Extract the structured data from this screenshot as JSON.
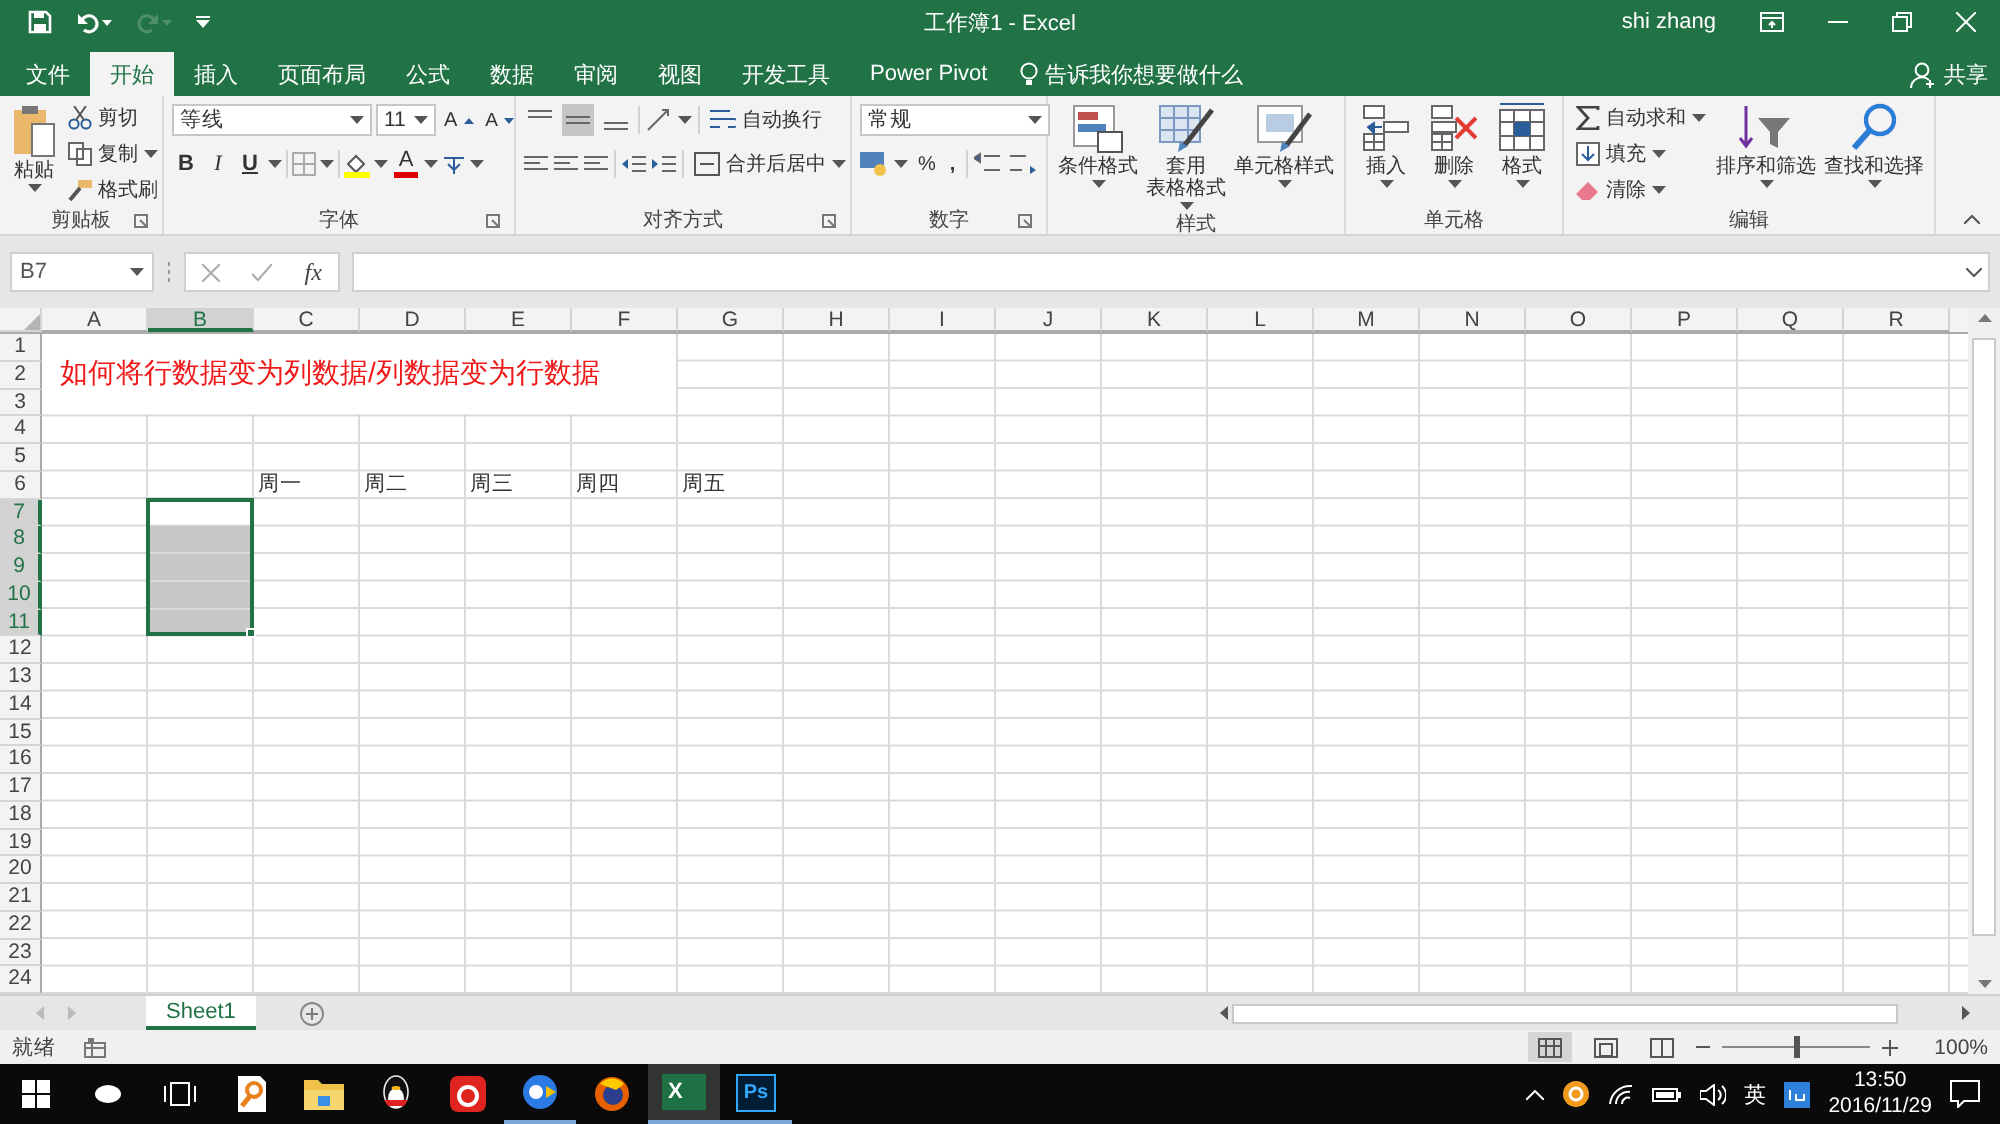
{
  "title_bar": {
    "title": "工作簿1 - Excel",
    "user": "shi zhang",
    "redo_disabled": true
  },
  "menu_tabs": [
    {
      "label": "文件",
      "selected": false
    },
    {
      "label": "开始",
      "selected": true
    },
    {
      "label": "插入",
      "selected": false
    },
    {
      "label": "页面布局",
      "selected": false
    },
    {
      "label": "公式",
      "selected": false
    },
    {
      "label": "数据",
      "selected": false
    },
    {
      "label": "审阅",
      "selected": false
    },
    {
      "label": "视图",
      "selected": false
    },
    {
      "label": "开发工具",
      "selected": false
    },
    {
      "label": "Power Pivot",
      "selected": false
    }
  ],
  "tell_me": "告诉我你想要做什么",
  "share": "共享",
  "ribbon": {
    "clipboard": {
      "label": "剪贴板",
      "paste": "粘贴",
      "cut": "剪切",
      "copy": "复制",
      "format_painter": "格式刷"
    },
    "font": {
      "label": "字体",
      "font_name": "等线",
      "font_size": "11",
      "grow": "A",
      "shrink": "A",
      "bold": "B",
      "italic": "I",
      "underline": "U",
      "font_color": "A"
    },
    "alignment": {
      "label": "对齐方式",
      "vertical": [
        {
          "kind": "top",
          "selected": false
        },
        {
          "kind": "middle",
          "selected": true
        },
        {
          "kind": "bottom",
          "selected": false
        }
      ],
      "wrap": "自动换行",
      "merge": "合并后居中"
    },
    "number": {
      "label": "数字",
      "format": "常规",
      "percent": "%",
      "comma": ","
    },
    "styles": {
      "label": "样式",
      "buttons": [
        {
          "kind": "conditional",
          "lines": [
            "条件格式"
          ]
        },
        {
          "kind": "table",
          "lines": [
            "套用",
            "表格格式"
          ]
        },
        {
          "kind": "cell",
          "lines": [
            "单元格样式"
          ]
        }
      ]
    },
    "cells": {
      "label": "单元格",
      "buttons": [
        {
          "kind": "insert",
          "label": "插入"
        },
        {
          "kind": "delete",
          "label": "删除"
        },
        {
          "kind": "format",
          "label": "格式"
        }
      ]
    },
    "editing": {
      "label": "编辑",
      "autosum": "自动求和",
      "fill": "填充",
      "clear": "清除",
      "sort": "排序和筛选",
      "find": "查找和选择"
    }
  },
  "formula_bar": {
    "name_box": "B7",
    "fx": "fx"
  },
  "sheet": {
    "columns": [
      {
        "label": "A",
        "selected": false
      },
      {
        "label": "B",
        "selected": true
      },
      {
        "label": "C",
        "selected": false
      },
      {
        "label": "D",
        "selected": false
      },
      {
        "label": "E",
        "selected": false
      },
      {
        "label": "F",
        "selected": false
      },
      {
        "label": "G",
        "selected": false
      },
      {
        "label": "H",
        "selected": false
      },
      {
        "label": "I",
        "selected": false
      },
      {
        "label": "J",
        "selected": false
      },
      {
        "label": "K",
        "selected": false
      },
      {
        "label": "L",
        "selected": false
      },
      {
        "label": "M",
        "selected": false
      },
      {
        "label": "N",
        "selected": false
      },
      {
        "label": "O",
        "selected": false
      },
      {
        "label": "P",
        "selected": false
      },
      {
        "label": "Q",
        "selected": false
      },
      {
        "label": "R",
        "selected": false
      }
    ],
    "rows": [
      {
        "label": "1",
        "selected": false
      },
      {
        "label": "2",
        "selected": false
      },
      {
        "label": "3",
        "selected": false
      },
      {
        "label": "4",
        "selected": false
      },
      {
        "label": "5",
        "selected": false
      },
      {
        "label": "6",
        "selected": false
      },
      {
        "label": "7",
        "selected": true
      },
      {
        "label": "8",
        "selected": true
      },
      {
        "label": "9",
        "selected": true
      },
      {
        "label": "10",
        "selected": true
      },
      {
        "label": "11",
        "selected": true
      },
      {
        "label": "12",
        "selected": false
      },
      {
        "label": "13",
        "selected": false
      },
      {
        "label": "14",
        "selected": false
      },
      {
        "label": "15",
        "selected": false
      },
      {
        "label": "16",
        "selected": false
      },
      {
        "label": "17",
        "selected": false
      },
      {
        "label": "18",
        "selected": false
      },
      {
        "label": "19",
        "selected": false
      },
      {
        "label": "20",
        "selected": false
      },
      {
        "label": "21",
        "selected": false
      },
      {
        "label": "22",
        "selected": false
      },
      {
        "label": "23",
        "selected": false
      },
      {
        "label": "24",
        "selected": false
      }
    ],
    "title": "如何将行数据变为列数据/列数据变为行数据",
    "weekdays": [
      "周一",
      "周二",
      "周三",
      "周四",
      "周五"
    ]
  },
  "sheet_tabs": [
    {
      "label": "Sheet1",
      "selected": true
    }
  ],
  "status_bar": {
    "status": "就绪",
    "zoom_slider": {
      "level": 0.5
    },
    "zoom": "100%"
  },
  "taskbar": {
    "apps": [
      {
        "kind": "start",
        "running": false,
        "selected": false
      },
      {
        "kind": "cortana",
        "running": false,
        "selected": false
      },
      {
        "kind": "taskview",
        "running": false,
        "selected": false
      },
      {
        "kind": "docsearch",
        "running": false,
        "selected": false
      },
      {
        "kind": "folder",
        "running": false,
        "selected": false
      },
      {
        "kind": "penguin",
        "running": false,
        "selected": false
      },
      {
        "kind": "music",
        "running": false,
        "selected": false
      },
      {
        "kind": "browser",
        "running": true,
        "selected": false
      },
      {
        "kind": "firefox",
        "running": false,
        "selected": false
      },
      {
        "kind": "excel",
        "running": true,
        "selected": true,
        "text": "X"
      },
      {
        "kind": "ps",
        "running": true,
        "selected": false,
        "text": "Ps"
      }
    ],
    "ime": "英",
    "time": "13:50",
    "date": "2016/11/29"
  }
}
